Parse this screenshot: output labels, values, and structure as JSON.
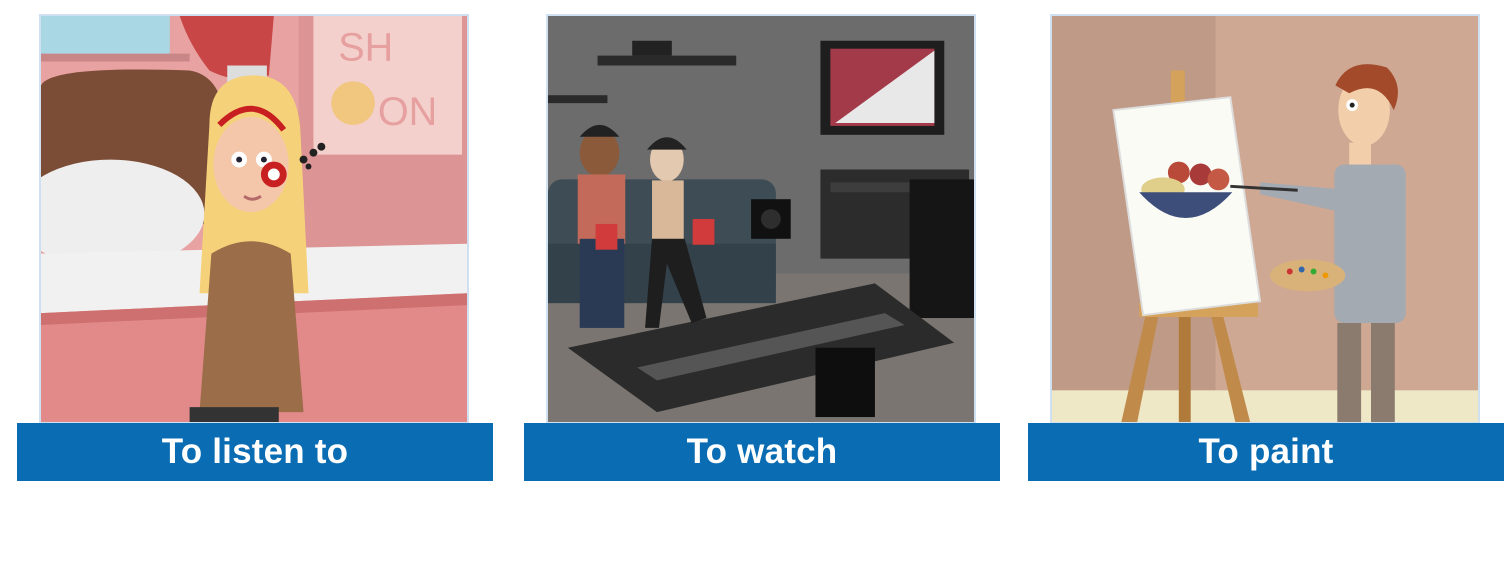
{
  "cards": [
    {
      "label": "To listen to",
      "scene": "girl-with-headphones-illustration"
    },
    {
      "label": "To watch",
      "scene": "couple-watching-tv-illustration"
    },
    {
      "label": "To paint",
      "scene": "man-painting-on-easel-illustration"
    }
  ],
  "colors": {
    "label_bg": "#0a6cb3",
    "label_text": "#ffffff",
    "frame_border": "#cfe1f0"
  }
}
